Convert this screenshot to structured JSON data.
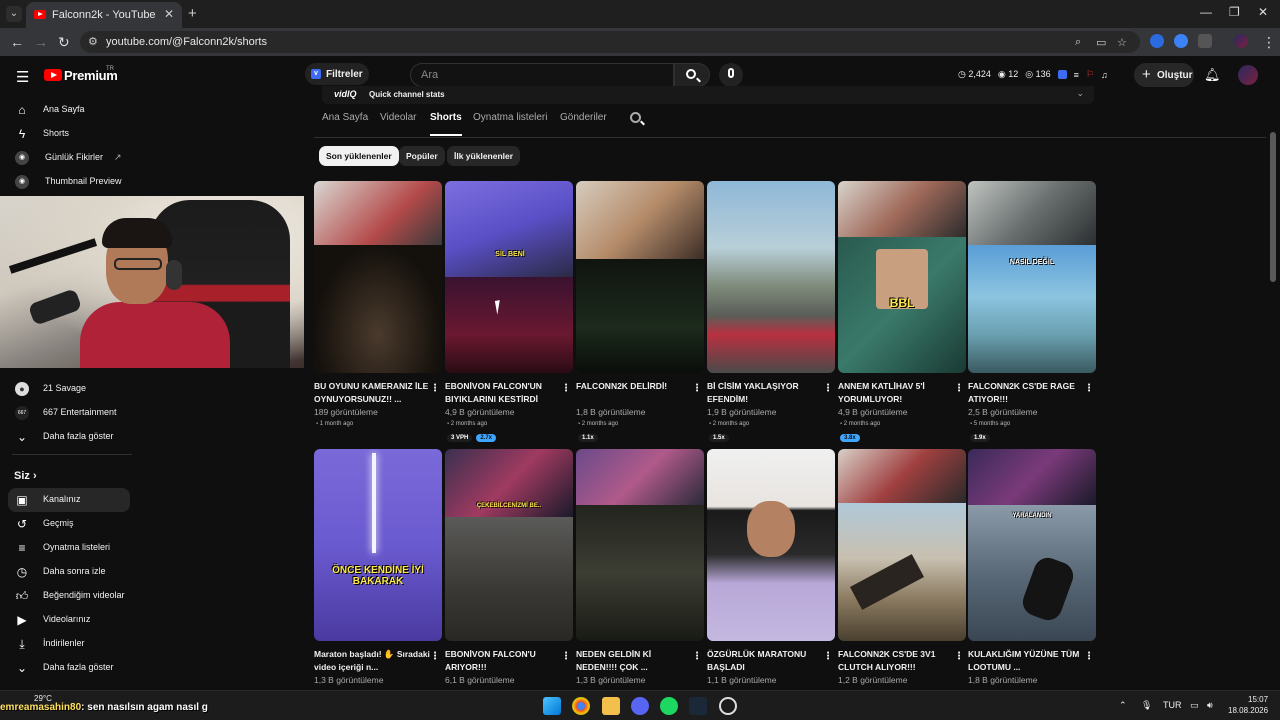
{
  "browser": {
    "tab_title": "Falconn2k - YouTube",
    "url": "youtube.com/@Falconn2k/shorts"
  },
  "header": {
    "brand": "Premium",
    "brand_region": "TR",
    "filter_label": "Filtreler",
    "search_placeholder": "Ara",
    "stats": {
      "views": "2,424",
      "watching": "12",
      "subs": "136"
    },
    "create_label": "Oluştur"
  },
  "sidebar": {
    "top_items": [
      {
        "label": "Ana Sayfa",
        "icon": "home-icon"
      },
      {
        "label": "Shorts",
        "icon": "shorts-icon"
      },
      {
        "label": "Günlük Fikirler",
        "icon": "idea-icon"
      },
      {
        "label": "Thumbnail Preview",
        "icon": "preview-icon"
      }
    ],
    "subscriptions": [
      {
        "label": "21 Savage"
      },
      {
        "label": "667 Entertainment"
      },
      {
        "label": "Daha fazla göster"
      }
    ],
    "you_section": "Siz",
    "you_items": [
      {
        "label": "Kanalınız",
        "icon": "channel-icon"
      },
      {
        "label": "Geçmiş",
        "icon": "history-icon"
      },
      {
        "label": "Oynatma listeleri",
        "icon": "playlist-icon"
      },
      {
        "label": "Daha sonra izle",
        "icon": "clock-icon"
      },
      {
        "label": "Beğendiğim videolar",
        "icon": "like-icon"
      },
      {
        "label": "Videolarınız",
        "icon": "video-icon"
      },
      {
        "label": "İndirilenler",
        "icon": "download-icon"
      },
      {
        "label": "Daha fazla göster",
        "icon": "chevron-down-icon"
      }
    ]
  },
  "vidiq": {
    "brand": "vidIQ",
    "text": "Quick channel stats"
  },
  "channel_tabs": [
    "Ana Sayfa",
    "Videolar",
    "Shorts",
    "Oynatma listeleri",
    "Gönderiler"
  ],
  "chips": [
    "Son yüklenenler",
    "Popüler",
    "İlk yüklenenler"
  ],
  "shorts": [
    {
      "title": "BU OYUNU KAMERANIZ İLE OYNUYORSUNUZ!! ...",
      "views": "189 görüntüleme",
      "ago": "1 month ago",
      "badges": []
    },
    {
      "title": "EBONİVON FALCON'UN BIYIKLARINI KESTİRDİ",
      "views": "4,9 B görüntüleme",
      "ago": "2 months ago",
      "badges": [
        "3 VPH",
        "2.7x"
      ]
    },
    {
      "title": "FALCONN2K DELİRDİ!",
      "views": "1,8 B görüntüleme",
      "ago": "2 months ago",
      "badges": [
        "1.1x"
      ]
    },
    {
      "title": "Bİ CİSİM YAKLAŞIYOR EFENDİM!",
      "views": "1,9 B görüntüleme",
      "ago": "2 months ago",
      "badges": [
        "1.5x"
      ]
    },
    {
      "title": "ANNEM KATLİHAV 5'İ YORUMLUYOR!",
      "views": "4,9 B görüntüleme",
      "ago": "2 months ago",
      "badges": [
        "3.8x"
      ]
    },
    {
      "title": "FALCONN2K CS'DE RAGE ATIYOR!!!",
      "views": "2,5 B görüntüleme",
      "ago": "5 months ago",
      "badges": [
        "1.9x"
      ]
    },
    {
      "title": "Maraton başladı! ✋ Sıradaki video içeriği n...",
      "views": "1,3 B görüntüleme"
    },
    {
      "title": "EBONİVON FALCON'U ARIYOR!!!",
      "views": "6,1 B görüntüleme"
    },
    {
      "title": "NEDEN GELDİN Kİ NEDEN!!!! ÇOK ...",
      "views": "1,3 B görüntüleme"
    },
    {
      "title": "ÖZGÜRLÜK MARATONU BAŞLADI",
      "views": "1,1 B görüntüleme"
    },
    {
      "title": "FALCONN2K CS'DE 3V1 CLUTCH ALIYOR!!!",
      "views": "1,2 B görüntüleme"
    },
    {
      "title": "KULAKLIĞIM YÜZÜNE TÜM LOOTUMU ...",
      "views": "1,8 B görüntüleme"
    }
  ],
  "thumb_overlays": {
    "card1": "SİL BENİ",
    "card4": "BBL",
    "card5": "NASIL DEĞİL",
    "card6": "ÖNCE KENDİNE İYİ BAKARAK",
    "card7": "ÇEKEBİLCENİZMİ BE..",
    "card11": "YARALANDIN"
  },
  "chat": {
    "user": "emreamasahin80",
    "message": ": sen nasılsın agam nasıl g"
  },
  "taskbar": {
    "temp": "29°C",
    "lang": "TUR",
    "time": "15:07",
    "date": "18.08.2026"
  }
}
